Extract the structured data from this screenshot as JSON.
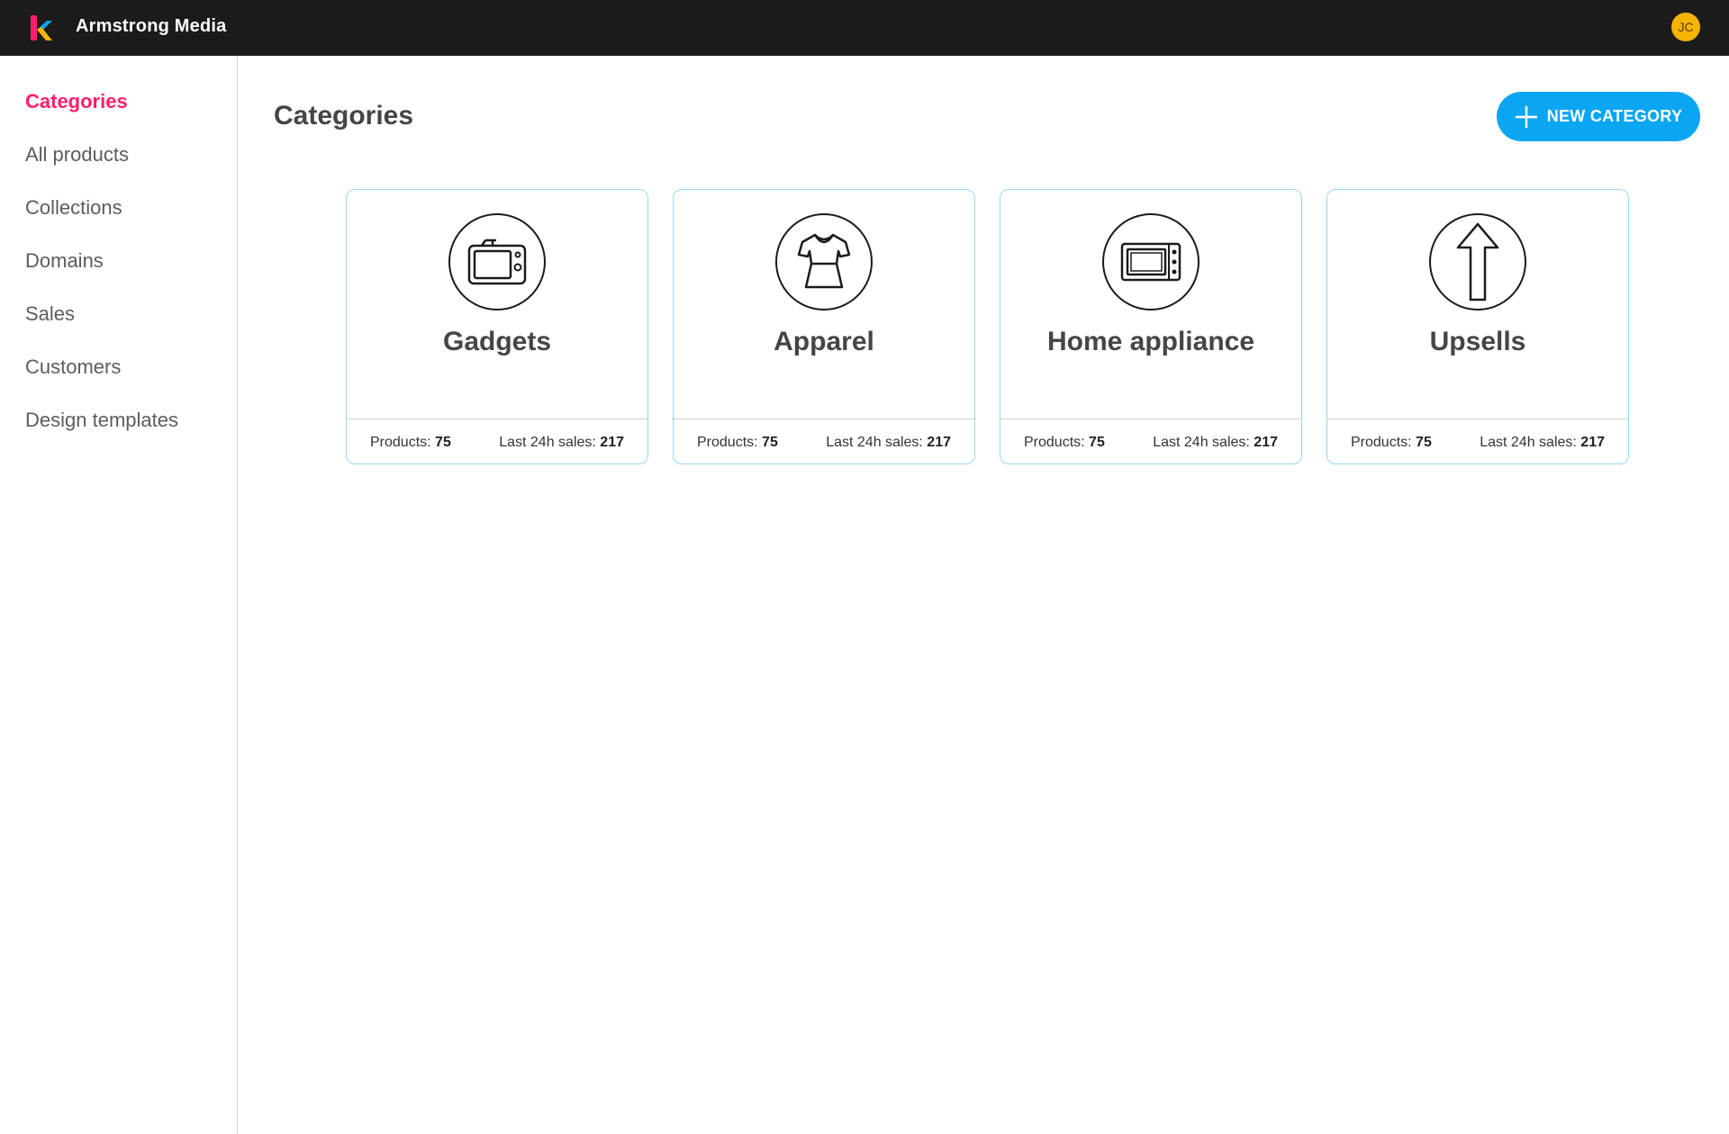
{
  "header": {
    "brand": "Armstrong Media",
    "logo_icon": "k-logo-icon",
    "avatar_initials": "JC"
  },
  "sidebar": {
    "items": [
      {
        "label": "Categories",
        "active": true
      },
      {
        "label": "All products",
        "active": false
      },
      {
        "label": "Collections",
        "active": false
      },
      {
        "label": "Domains",
        "active": false
      },
      {
        "label": "Sales",
        "active": false
      },
      {
        "label": "Customers",
        "active": false
      },
      {
        "label": "Design templates",
        "active": false
      }
    ]
  },
  "main": {
    "title": "Categories",
    "new_button_label": "NEW CATEGORY",
    "cards": [
      {
        "name": "Gadgets",
        "icon": "tv-icon",
        "products_label": "Products:",
        "products": "75",
        "sales_label": "Last 24h sales:",
        "sales": "217"
      },
      {
        "name": "Apparel",
        "icon": "shirt-icon",
        "products_label": "Products:",
        "products": "75",
        "sales_label": "Last 24h sales:",
        "sales": "217"
      },
      {
        "name": "Home appliance",
        "icon": "microwave-icon",
        "products_label": "Products:",
        "products": "75",
        "sales_label": "Last 24h sales:",
        "sales": "217"
      },
      {
        "name": "Upsells",
        "icon": "arrow-up-icon",
        "products_label": "Products:",
        "products": "75",
        "sales_label": "Last 24h sales:",
        "sales": "217"
      }
    ]
  },
  "colors": {
    "topbar": "#1b1b1b",
    "accent_pink": "#ff1e6e",
    "button_blue": "#0aa6f2",
    "card_border": "#9bd6f2",
    "avatar": "#f5b400"
  }
}
